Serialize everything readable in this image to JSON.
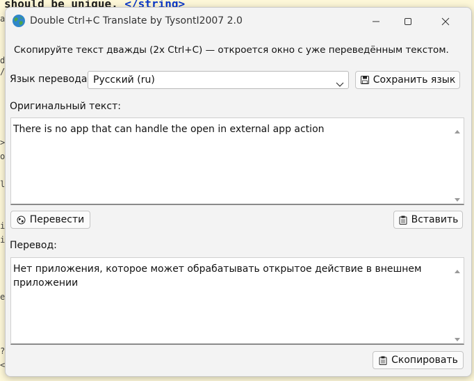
{
  "background": {
    "code_line": "should be unique.",
    "code_tag": "</string>",
    "gutter_chars": [
      "a",
      "d",
      "/",
      ">",
      "o",
      "l",
      "i",
      "i",
      "e",
      "?",
      "<"
    ]
  },
  "window": {
    "title": "Double Ctrl+C Translate by TysontI2007 2.0",
    "hint": "Скопируйте текст дважды (2x Ctrl+C) — откроется окно с уже переведённым текстом.",
    "language": {
      "label": "Язык перевода:",
      "selected": "Русский (ru)",
      "save_button": "Сохранить язык"
    },
    "original": {
      "label": "Оригинальный текст:",
      "text": "There is no app that can handle the open in external app action",
      "translate_button": "Перевести",
      "paste_button": "Вставить"
    },
    "translation": {
      "label": "Перевод:",
      "text": "Нет приложения, которое может обрабатывать открытое действие в внешнем приложении",
      "copy_button": "Скопировать"
    }
  },
  "colors": {
    "background_editor": "#fdf7d8",
    "window_bg": "#f3f3f3",
    "code_tag": "#0b38c8"
  },
  "icons": {
    "app": "globe-icon",
    "save": "floppy-disk-icon",
    "translate": "globe-small-icon",
    "paste": "clipboard-icon",
    "copy": "clipboard-icon"
  }
}
